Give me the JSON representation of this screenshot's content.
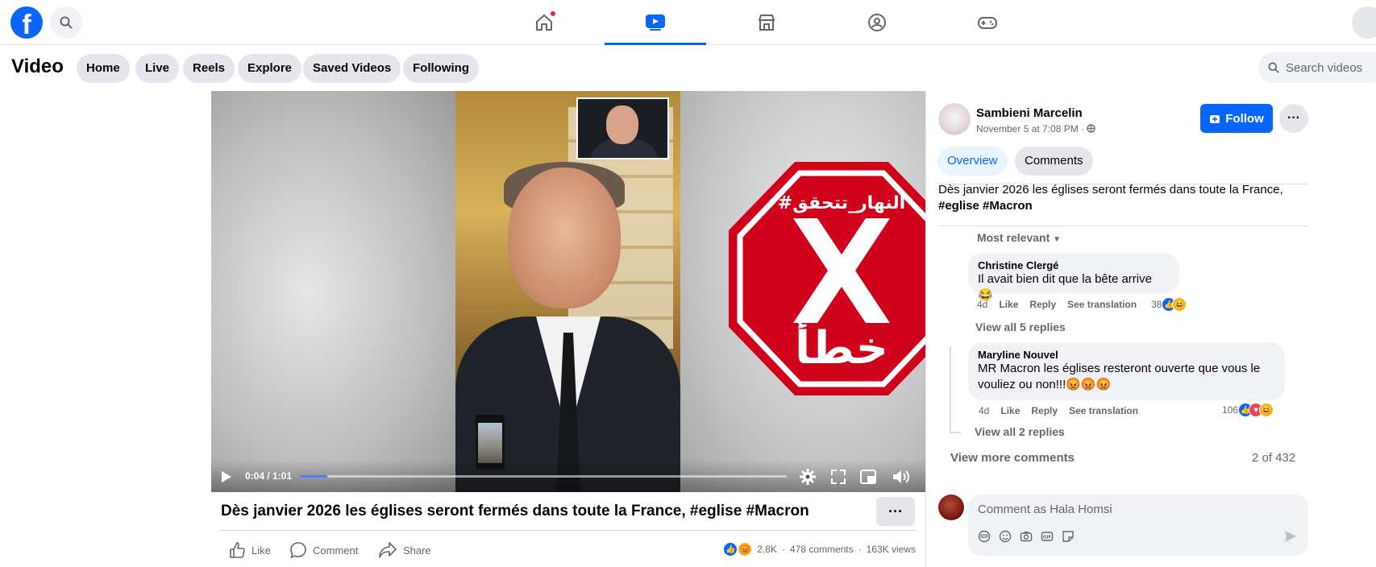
{
  "nav": {
    "logo_letter": "f",
    "tabs": [
      "home",
      "video",
      "marketplace",
      "groups",
      "gaming"
    ]
  },
  "subnav": {
    "title": "Video",
    "pills": [
      "Home",
      "Live",
      "Reels",
      "Explore",
      "Saved Videos",
      "Following"
    ],
    "search_placeholder": "Search videos"
  },
  "player": {
    "overlay_hashtag": "#النهار_تتحقق",
    "overlay_verdict": "خطأ",
    "time_current": "0:04",
    "time_total": "1:01",
    "time_display": "0:04 / 1:01",
    "progress_fraction": 0.056
  },
  "post": {
    "title": "Dès janvier 2026 les églises seront fermés dans toute la France, #eglise #Macron",
    "actions": [
      "Like",
      "Comment",
      "Share"
    ],
    "reactions_count": "2.8K",
    "comments_count": "478 comments",
    "views": "163K views"
  },
  "sidebar": {
    "author": "Sambieni Marcelin",
    "meta": "November 5 at 7:08 PM ·",
    "follow_label": "Follow",
    "tabs": [
      "Overview",
      "Comments"
    ],
    "description_line1": "Dès janvier 2026 les églises seront fermés dans toute la France,",
    "description_line2": "#eglise #Macron",
    "sort_label": "Most relevant",
    "comments": [
      {
        "name": "Christine Clergé",
        "text": "Il avait bien dit que la bête arrive 😂",
        "age": "4d",
        "like": "Like",
        "reply": "Reply",
        "translate": "See translation",
        "reactions": "38",
        "replies": "View all 5 replies"
      },
      {
        "name": "Maryline Nouvel",
        "text_line1": "MR Macron les églises resteront ouverte que vous le",
        "text_line2": "vouliez ou non!!!😡😡😡",
        "age": "4d",
        "like": "Like",
        "reply": "Reply",
        "translate": "See translation",
        "reactions": "106",
        "replies": "View all 2 replies"
      }
    ],
    "more_comments": "View more comments",
    "comment_count": "2 of 432",
    "composer_placeholder": "Comment as Hala Homsi"
  },
  "colors": {
    "brand": "#0866ff",
    "stop_red": "#d0021b",
    "text_secondary": "#65676b"
  }
}
